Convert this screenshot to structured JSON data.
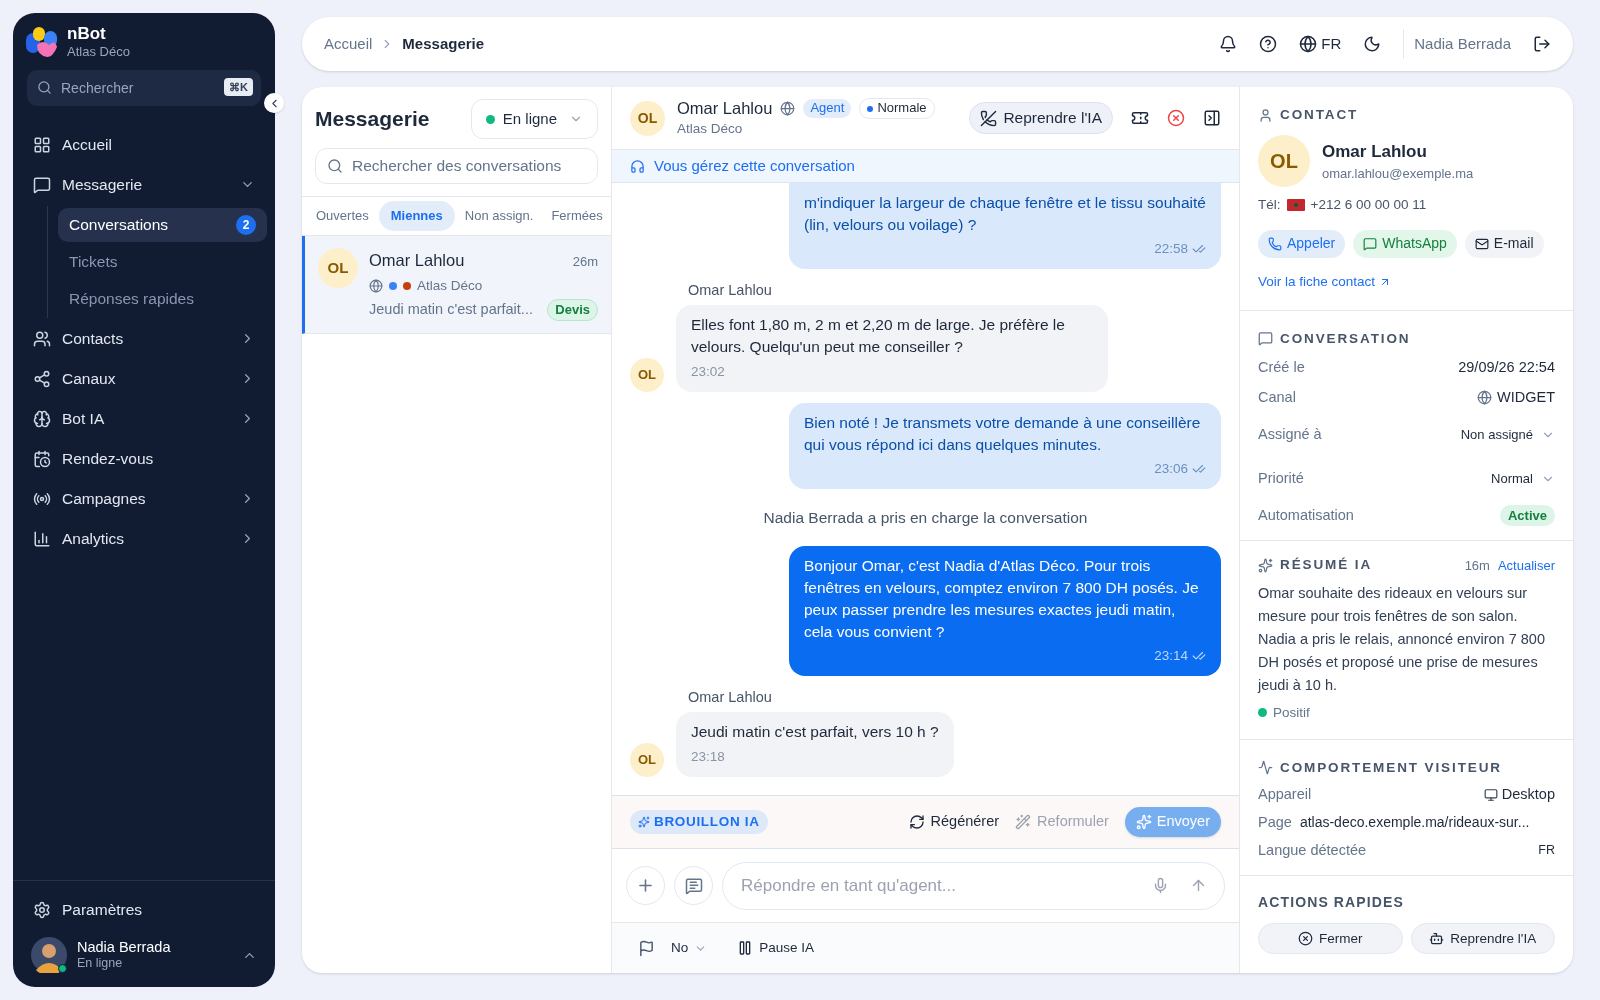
{
  "sidebar": {
    "brand": "nBot",
    "workspace": "Atlas Déco",
    "search": {
      "placeholder": "Rechercher",
      "shortcut": "⌘K"
    },
    "items": [
      {
        "label": "Accueil",
        "submenu": false
      },
      {
        "label": "Messagerie",
        "submenu": true,
        "expanded": true,
        "children": [
          {
            "label": "Conversations",
            "selected": true,
            "badge": "2"
          },
          {
            "label": "Tickets",
            "selected": false
          },
          {
            "label": "Réponses rapides",
            "selected": false
          }
        ]
      },
      {
        "label": "Contacts",
        "submenu": true,
        "expanded": false
      },
      {
        "label": "Canaux",
        "submenu": true,
        "expanded": false
      },
      {
        "label": "Bot IA",
        "submenu": true,
        "expanded": false
      },
      {
        "label": "Rendez-vous",
        "submenu": false
      },
      {
        "label": "Campagnes",
        "submenu": true,
        "expanded": false
      },
      {
        "label": "Analytics",
        "submenu": true,
        "expanded": false
      }
    ],
    "settings": "Paramètres",
    "user": {
      "name": "Nadia Berrada",
      "status": "En ligne",
      "online": true
    }
  },
  "topbar": {
    "breadcrumb": [
      "Accueil",
      "Messagerie"
    ],
    "language": "FR",
    "user": "Nadia Berrada"
  },
  "inbox": {
    "title": "Messagerie",
    "status": {
      "label": "En ligne",
      "color": "#10b981"
    },
    "search": {
      "placeholder": "Rechercher des conversations"
    },
    "tabs": [
      {
        "label": "Ouvertes",
        "selected": false
      },
      {
        "label": "Miennes",
        "selected": true
      },
      {
        "label": "Non assign.",
        "selected": false
      },
      {
        "label": "Fermées",
        "selected": false
      }
    ],
    "conversations": [
      {
        "initials": "OL",
        "name": "Omar Lahlou",
        "time": "26m",
        "company": "Atlas Déco",
        "dots": [
          {
            "color": "#3b82f6"
          },
          {
            "color": "#c2410c"
          }
        ],
        "preview": "Jeudi matin c'est parfait...",
        "tag": "Devis",
        "selected": true
      }
    ]
  },
  "chat": {
    "header": {
      "initials": "OL",
      "name": "Omar Lahlou",
      "company": "Atlas Déco",
      "role": "Agent",
      "priority": "Normale",
      "takeover": "Reprendre l'IA"
    },
    "banner": "Vous gérez cette conversation",
    "messages": [
      {
        "kind": "bot",
        "text": "m'indiquer la largeur de chaque fenêtre et le tissu souhaité (lin, velours ou voilage) ?",
        "time": "22:58"
      },
      {
        "kind": "contact",
        "author": "Omar Lahlou",
        "initials": "OL",
        "text": "Elles font 1,80 m, 2 m et 2,20 m de large. Je préfère le velours. Quelqu'un peut me conseiller ?",
        "time": "23:02"
      },
      {
        "kind": "bot",
        "text": "Bien noté ! Je transmets votre demande à une conseillère qui vous répond ici dans quelques minutes.",
        "time": "23:06"
      },
      {
        "kind": "system",
        "text": "Nadia Berrada a pris en charge la conversation"
      },
      {
        "kind": "agent",
        "text": "Bonjour Omar, c'est Nadia d'Atlas Déco. Pour trois fenêtres en velours, comptez environ 7 800 DH posés. Je peux passer prendre les mesures exactes jeudi matin, cela vous convient ?",
        "time": "23:14"
      },
      {
        "kind": "contact",
        "author": "Omar Lahlou",
        "initials": "OL",
        "text": "Jeudi matin c'est parfait, vers 10 h ?",
        "time": "23:18"
      }
    ],
    "draft": {
      "label": "BROUILLON IA",
      "actions": [
        {
          "label": "Régénérer",
          "disabled": false
        },
        {
          "label": "Reformuler",
          "disabled": true
        }
      ],
      "send": "Envoyer"
    },
    "composer": {
      "placeholder": "Répondre en tant qu'agent..."
    },
    "footer": {
      "priority": "No",
      "pause": "Pause IA"
    }
  },
  "details": {
    "contact": {
      "heading": "CONTACT",
      "initials": "OL",
      "name": "Omar Lahlou",
      "email": "omar.lahlou@exemple.ma",
      "phone_label": "Tél:",
      "phone": "+212 6 00 00 00 11",
      "actions": [
        "Appeler",
        "WhatsApp",
        "E-mail"
      ],
      "link": "Voir la fiche contact"
    },
    "conversation": {
      "heading": "CONVERSATION",
      "rows": [
        {
          "kind": "text",
          "label": "Créé le",
          "value": "29/09/26 22:54"
        },
        {
          "kind": "channel",
          "label": "Canal",
          "value": "WIDGET"
        },
        {
          "kind": "select",
          "label": "Assigné à",
          "value": "Non assigné"
        },
        {
          "kind": "select",
          "label": "Priorité",
          "value": "Normal"
        },
        {
          "kind": "badge",
          "label": "Automatisation",
          "value": "Active"
        }
      ]
    },
    "summary": {
      "heading": "RÉSUMÉ IA",
      "age": "16m",
      "refresh": "Actualiser",
      "text": "Omar souhaite des rideaux en velours sur mesure pour trois fenêtres de son salon. Nadia a pris le relais, annoncé environ 7 800 DH posés et proposé une prise de mesures jeudi à 10 h.",
      "sentiment": {
        "label": "Positif",
        "color": "#10b981"
      }
    },
    "visitor": {
      "heading": "COMPORTEMENT VISITEUR",
      "rows": [
        {
          "kind": "device",
          "label": "Appareil",
          "value": "Desktop"
        },
        {
          "kind": "page",
          "label": "Page",
          "value": "atlas-deco.exemple.ma/rideaux-sur..."
        },
        {
          "kind": "text",
          "label": "Langue détectée",
          "value": "FR"
        }
      ]
    },
    "quick": {
      "heading": "ACTIONS RAPIDES",
      "actions": [
        "Fermer",
        "Reprendre l'IA"
      ]
    }
  }
}
